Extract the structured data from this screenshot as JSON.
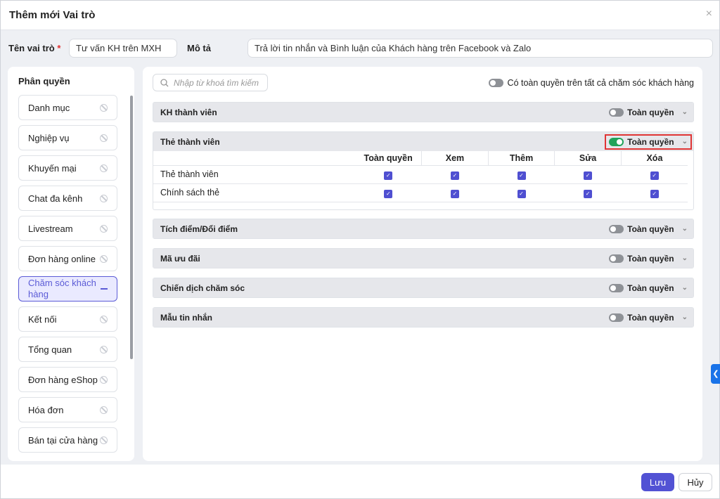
{
  "dialog": {
    "title": "Thêm mới Vai trò",
    "close": "×"
  },
  "form": {
    "name_label": "Tên vai trò",
    "required": "*",
    "name_value": "Tư vấn KH trên MXH",
    "desc_label": "Mô tả",
    "desc_value": "Trả lời tin nhắn và Bình luận của Khách hàng trên Facebook và Zalo"
  },
  "sidebar": {
    "title": "Phân quyền",
    "items": [
      {
        "label": "Danh mục"
      },
      {
        "label": "Nghiệp vụ"
      },
      {
        "label": "Khuyến mại"
      },
      {
        "label": "Chat đa kênh"
      },
      {
        "label": "Livestream"
      },
      {
        "label": "Đơn hàng online"
      },
      {
        "label": "Chăm sóc khách hàng"
      },
      {
        "label": "Kết nối"
      },
      {
        "label": "Tổng quan"
      },
      {
        "label": "Đơn hàng eShop"
      },
      {
        "label": "Hóa đơn"
      },
      {
        "label": "Bán tại cửa hàng"
      }
    ]
  },
  "main": {
    "search_placeholder": "Nhập từ khoá tìm kiếm",
    "all_toggle_label": "Có toàn quyền trên tất cả chăm sóc khách hàng",
    "full_label": "Toàn quyền",
    "sections": [
      {
        "title": "KH thành viên",
        "on": false
      },
      {
        "title": "Thẻ thành viên",
        "on": true
      },
      {
        "title": "Tích điểm/Đổi điểm",
        "on": false
      },
      {
        "title": "Mã ưu đãi",
        "on": false
      },
      {
        "title": "Chiến dịch chăm sóc",
        "on": false
      },
      {
        "title": "Mẫu tin nhắn",
        "on": false
      }
    ],
    "columns": [
      "Toàn quyền",
      "Xem",
      "Thêm",
      "Sửa",
      "Xóa"
    ],
    "rows": [
      {
        "label": "Thẻ thành viên",
        "checked": [
          true,
          true,
          true,
          true,
          true
        ]
      },
      {
        "label": "Chính sách thẻ",
        "checked": [
          true,
          true,
          true,
          true,
          true
        ]
      }
    ]
  },
  "footer": {
    "save": "Lưu",
    "cancel": "Hủy"
  },
  "colors": {
    "accent": "#5252d4",
    "toggle_on": "#21a35a",
    "highlight": "#e03535"
  }
}
